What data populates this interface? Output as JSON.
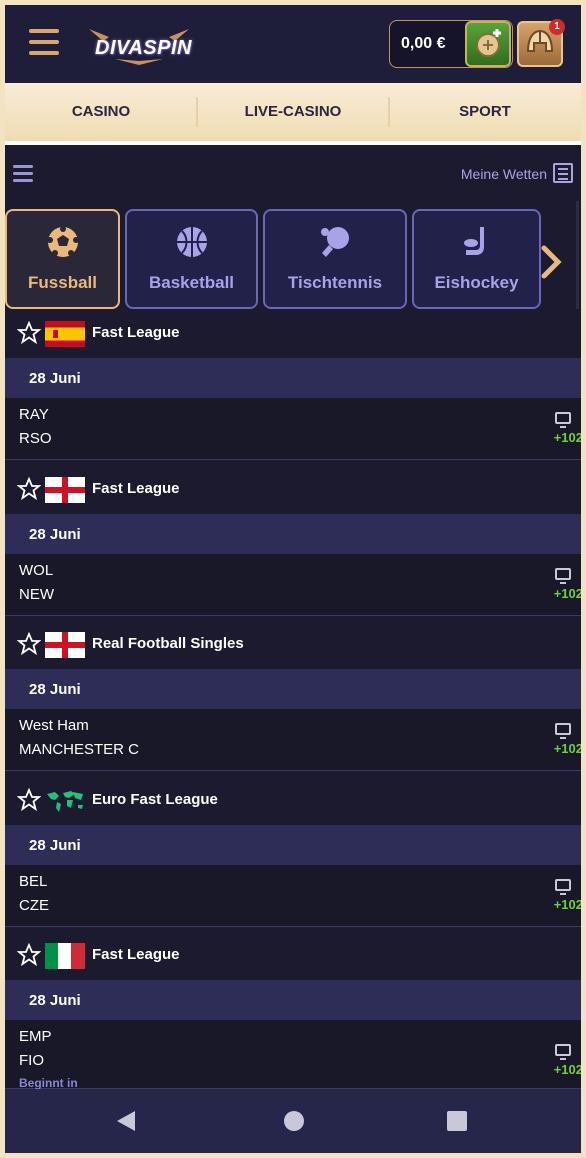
{
  "header": {
    "logo_text": "DIVASPIN",
    "balance": "0,00 €",
    "notification_count": "1"
  },
  "topnav": {
    "items": [
      {
        "label": "CASINO"
      },
      {
        "label": "LIVE-CASINO"
      },
      {
        "label": "SPORT"
      }
    ]
  },
  "subbar": {
    "my_bets_label": "Meine Wetten"
  },
  "sports": [
    {
      "label": "Fussball",
      "icon": "soccer-ball-icon",
      "active": true
    },
    {
      "label": "Basketball",
      "icon": "basketball-icon",
      "active": false
    },
    {
      "label": "Tischtennis",
      "icon": "table-tennis-icon",
      "active": false
    },
    {
      "label": "Eishockey",
      "icon": "hockey-icon",
      "active": false
    }
  ],
  "leagues": [
    {
      "name": "Fast League",
      "flag": "spain-flag-icon",
      "date": "28 Juni",
      "home": "RAY",
      "away": "RSO",
      "markets": "+102"
    },
    {
      "name": "Fast League",
      "flag": "england-flag-icon",
      "date": "28 Juni",
      "home": "WOL",
      "away": "NEW",
      "markets": "+102"
    },
    {
      "name": "Real Football Singles",
      "flag": "england-flag-icon",
      "date": "28 Juni",
      "home": "West Ham",
      "away": "MANCHESTER C",
      "markets": "+102"
    },
    {
      "name": "Euro Fast League",
      "flag": "world-map-icon",
      "date": "28 Juni",
      "home": "BEL",
      "away": "CZE",
      "markets": "+102"
    },
    {
      "name": "Fast League",
      "flag": "italy-flag-icon",
      "date": "28 Juni",
      "home": "EMP",
      "away": "FIO",
      "markets": "+102",
      "begins": "Beginnt in"
    }
  ],
  "colors": {
    "accent": "#e8b97a",
    "tile_border": "#6a66b8",
    "date_row": "#2e2d57",
    "markets_green": "#6fcf3f"
  }
}
